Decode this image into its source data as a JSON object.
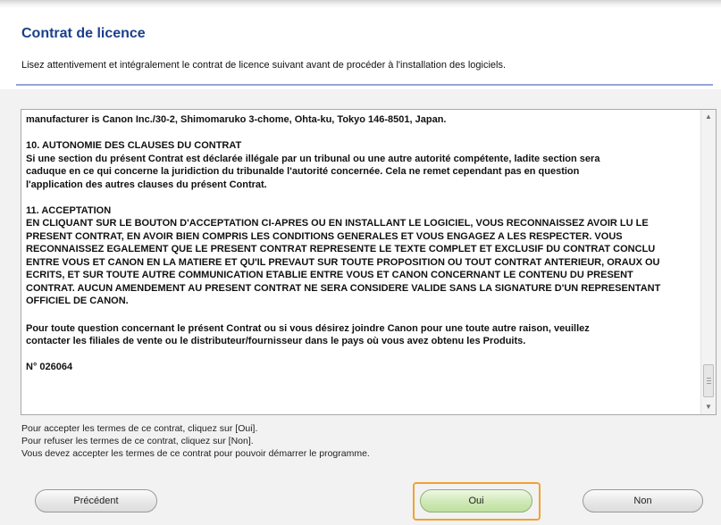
{
  "header": {
    "title": "Contrat de licence",
    "intro": "Lisez attentivement et intégralement le contrat de licence suivant avant de procéder à l'installation des logiciels."
  },
  "license": {
    "lines": [
      "manufacturer is Canon Inc./30-2, Shimomaruko 3-chome, Ohta-ku, Tokyo 146-8501, Japan.",
      "10. AUTONOMIE DES CLAUSES DU CONTRAT",
      "Si une section du présent Contrat est déclarée illégale par un tribunal ou une autre autorité compétente, ladite section sera",
      "caduque en ce qui concerne la juridiction du tribunalde l'autorité concernée. Cela ne remet cependant pas en question",
      "l'application des autres clauses du présent Contrat.",
      "11. ACCEPTATION",
      "EN CLIQUANT SUR LE BOUTON D'ACCEPTATION CI-APRES OU EN INSTALLANT LE LOGICIEL, VOUS RECONNAISSEZ AVOIR LU LE",
      "PRESENT CONTRAT, EN AVOIR BIEN COMPRIS LES CONDITIONS GENERALES ET VOUS ENGAGEZ A LES RESPECTER. VOUS",
      "RECONNAISSEZ EGALEMENT QUE LE PRESENT CONTRAT REPRESENTE LE TEXTE COMPLET ET EXCLUSIF DU CONTRAT CONCLU",
      "ENTRE VOUS ET CANON EN LA MATIERE ET QU'IL PREVAUT SUR TOUTE PROPOSITION OU TOUT CONTRAT ANTERIEUR, ORAUX OU",
      "ECRITS, ET SUR TOUTE AUTRE COMMUNICATION ETABLIE ENTRE VOUS ET CANON CONCERNANT LE CONTENU DU PRESENT",
      "CONTRAT. AUCUN AMENDEMENT AU PRESENT CONTRAT NE SERA CONSIDERE VALIDE SANS LA SIGNATURE D'UN REPRESENTANT",
      "OFFICIEL DE CANON.",
      "Pour toute question concernant le présent Contrat ou si vous désirez joindre Canon pour une toute autre raison, veuillez",
      "contacter les filiales de vente ou le distributeur/fournisseur dans le pays où vous avez obtenu les Produits.",
      "N° 026064"
    ]
  },
  "instructions": {
    "line1": "Pour accepter les termes de ce contrat, cliquez sur [Oui].",
    "line2": "Pour refuser les termes de ce contrat, cliquez sur [Non].",
    "line3": "Vous devez accepter les termes de ce contrat pour pouvoir démarrer le programme."
  },
  "buttons": {
    "previous": "Précédent",
    "yes": "Oui",
    "no": "Non"
  },
  "scrollbar": {
    "up_icon": "triangle-up",
    "down_icon": "triangle-down",
    "position_fraction": 0.93
  },
  "colors": {
    "title": "#1a3f8c",
    "focus_ring": "#f0a232",
    "yes_button": "#cfe9b6"
  }
}
